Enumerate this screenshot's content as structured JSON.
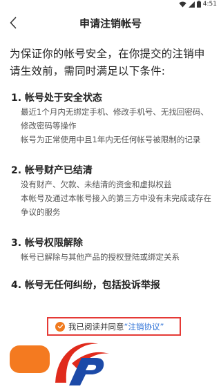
{
  "status": {
    "time": "4:51"
  },
  "header": {
    "title": "申请注销帐号"
  },
  "intro": "为保证你的帐号安全，在你提交的注销申请生效前，需同时满足以下条件:",
  "sections": [
    {
      "title": "1. 帐号处于安全状态",
      "lines": [
        "最近1个月内无绑定手机、修改手机号、无找回密码、修改密码等操作",
        "帐号为正常使用中且1年内无任何帐号被限制的记录"
      ]
    },
    {
      "title": "2. 帐号财产已结清",
      "lines": [
        "没有财产、欠款、未结清的资金和虚拟权益",
        "本帐号及通过本帐号接入的第三方中没有未完成或存在争议的服务"
      ]
    },
    {
      "title": "3. 帐号权限解除",
      "lines": [
        "帐号已解除与其他产品的授权登陆或绑定关系"
      ]
    },
    {
      "title": "4. 帐号无任何纠纷，包括投诉举报",
      "lines": []
    }
  ],
  "agreement": {
    "prefix": "我已阅读并同意",
    "link": "“注销协议”",
    "checked": true
  },
  "colors": {
    "accent": "#f47a20",
    "link": "#2a6fd6",
    "highlight": "#e53935"
  },
  "icons": {
    "back": "chevron-left-icon",
    "check": "check-circle-icon"
  }
}
